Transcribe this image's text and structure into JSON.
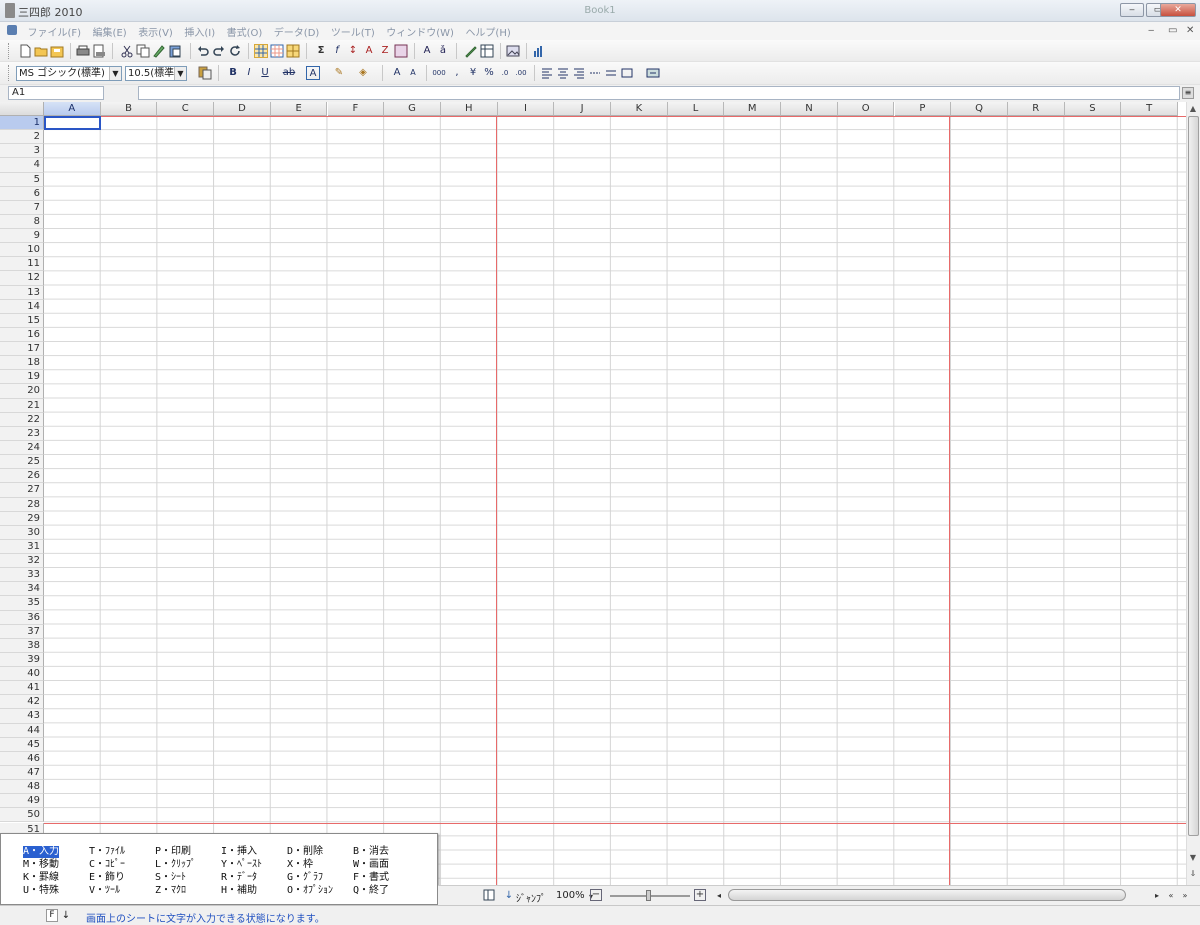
{
  "window": {
    "app_title": "三四郎 2010",
    "doc_title": "Book1",
    "controls": [
      "‒",
      "▭",
      "✕"
    ]
  },
  "menubar": {
    "items": [
      "ファイル(F)",
      "編集(E)",
      "表示(V)",
      "挿入(I)",
      "書式(O)",
      "データ(D)",
      "ツール(T)",
      "ウィンドウ(W)",
      "ヘルプ(H)"
    ],
    "mdi_controls": [
      "‒",
      "▭",
      "✕"
    ]
  },
  "toolbar2": {
    "font_name": "MS ゴシック(標準)",
    "font_size": "10.5(標準)"
  },
  "formula_bar": {
    "cell_ref": "A1",
    "formula": ""
  },
  "sheet": {
    "columns": [
      "A",
      "B",
      "C",
      "D",
      "E",
      "F",
      "G",
      "H",
      "I",
      "J",
      "K",
      "L",
      "M",
      "N",
      "O",
      "P",
      "Q",
      "R",
      "S",
      "T"
    ],
    "rows": [
      "1",
      "2",
      "3",
      "4",
      "5",
      "6",
      "7",
      "8",
      "9",
      "10",
      "11",
      "12",
      "13",
      "14",
      "15",
      "16",
      "17",
      "18",
      "19",
      "20",
      "21",
      "22",
      "23",
      "24",
      "25",
      "26",
      "27",
      "28",
      "29",
      "30",
      "31",
      "32",
      "33",
      "34",
      "35",
      "36",
      "37",
      "38",
      "39",
      "40",
      "41",
      "42",
      "43",
      "44",
      "45",
      "46",
      "47",
      "48",
      "49",
      "50",
      "51"
    ],
    "selected_cell": "A1"
  },
  "shortcuts": [
    [
      "A・入力",
      "T・ﾌｧｲﾙ",
      "P・印刷",
      "I・挿入",
      "D・削除",
      "B・消去"
    ],
    [
      "M・移動",
      "C・ｺﾋﾟｰ",
      "L・ｸﾘｯﾌﾟ",
      "Y・ﾍﾟｰｽﾄ",
      "X・枠",
      "W・画面"
    ],
    [
      "K・罫線",
      "E・飾り",
      "S・ｼｰﾄ",
      "R・ﾃﾞｰﾀ",
      "G・ｸﾞﾗﾌ",
      "F・書式"
    ],
    [
      "U・特殊",
      "V・ﾂｰﾙ",
      "Z・ﾏｸﾛ",
      "H・補助",
      "O・ｵﾌﾟｼｮﾝ",
      "Q・終了"
    ]
  ],
  "bottom_bar": {
    "jump_label": "ｼﾞｬﾝﾌﾟ",
    "zoom": "100%"
  },
  "status": {
    "key": "F",
    "message": "画面上のシートに文字が入力できる状態になります。"
  }
}
